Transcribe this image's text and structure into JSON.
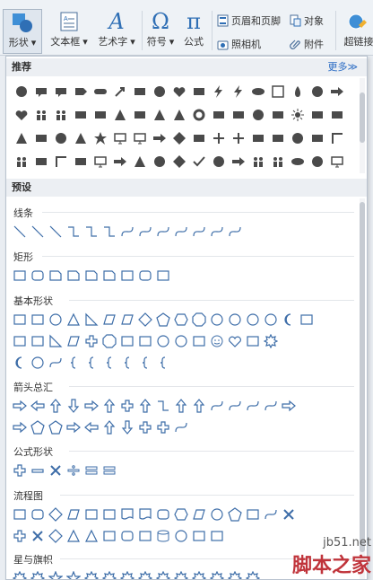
{
  "colors": {
    "accent": "#2b6cc4",
    "icon_fill": "#4a4a4a",
    "outline": "#3d6da8",
    "watermark_red": "#c0343b"
  },
  "ribbon": {
    "shapes_label": "形状",
    "textbox_label": "文本框",
    "wordart_label": "艺术字",
    "symbol_label": "符号",
    "formula_label": "公式",
    "header_footer_label": "页眉和页脚",
    "object_label": "对象",
    "camera_label": "照相机",
    "attachment_label": "附件",
    "hyperlink_label": "超链接"
  },
  "panel": {
    "recommended_title": "推荐",
    "more_link": "更多≫",
    "presets_title": "预设",
    "categories": {
      "lines": "线条",
      "rectangles": "矩形",
      "basic_shapes": "基本形状",
      "block_arrows": "箭头总汇",
      "equation_shapes": "公式形状",
      "flowchart": "流程图",
      "stars_banners": "星与旗帜"
    }
  },
  "watermark": {
    "site": "jb51.net",
    "brand": "脚本之家"
  }
}
